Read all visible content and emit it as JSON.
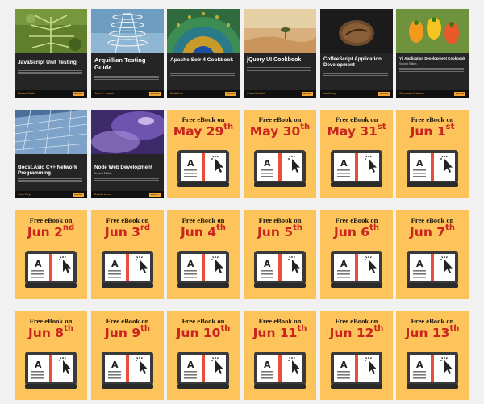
{
  "colors": {
    "page_background": "#f1f1f1",
    "ebook_background": "#fcc45a",
    "ebook_date_color": "#c9241d",
    "book_dark": "#252525",
    "publisher_orange": "#f4a532"
  },
  "book_covers": [
    {
      "title": "JavaScript Unit Testing",
      "subtitle": "",
      "author": "Hazem Saleh",
      "publisher": "PACKT"
    },
    {
      "title": "Arquillian Testing Guide",
      "subtitle": "",
      "author": "John D. Ament",
      "publisher": "PACKT"
    },
    {
      "title": "Apache Solr 4 Cookbook",
      "subtitle": "",
      "author": "Rafał Kuć",
      "publisher": "PACKT"
    },
    {
      "title": "jQuery UI Cookbook",
      "subtitle": "",
      "author": "Adam Boduch",
      "publisher": "PACKT"
    },
    {
      "title": "CoffeeScript Application Development",
      "subtitle": "",
      "author": "Ian Young",
      "publisher": "PACKT"
    },
    {
      "title": "Yii Application Development Cookbook",
      "subtitle": "Second Edition",
      "author": "Alexander Makarov",
      "publisher": "PACKT"
    },
    {
      "title": "Boost.Asio C++ Network Programming",
      "subtitle": "",
      "author": "John Torjo",
      "publisher": "PACKT"
    },
    {
      "title": "Node Web Development",
      "subtitle": "Second Edition",
      "author": "David Herron",
      "publisher": "PACKT"
    }
  ],
  "free_ebooks": {
    "label": "Free eBook on",
    "dates": [
      {
        "text": "May 29",
        "suffix": "th"
      },
      {
        "text": "May 30",
        "suffix": "th"
      },
      {
        "text": "May 31",
        "suffix": "st"
      },
      {
        "text": "Jun 1",
        "suffix": "st"
      },
      {
        "text": "Jun 2",
        "suffix": "nd"
      },
      {
        "text": "Jun 3",
        "suffix": "rd"
      },
      {
        "text": "Jun 4",
        "suffix": "th"
      },
      {
        "text": "Jun 5",
        "suffix": "th"
      },
      {
        "text": "Jun 6",
        "suffix": "th"
      },
      {
        "text": "Jun 7",
        "suffix": "th"
      },
      {
        "text": "Jun 8",
        "suffix": "th"
      },
      {
        "text": "Jun 9",
        "suffix": "th"
      },
      {
        "text": "Jun 10",
        "suffix": "th"
      },
      {
        "text": "Jun 11",
        "suffix": "th"
      },
      {
        "text": "Jun 12",
        "suffix": "th"
      },
      {
        "text": "Jun 13",
        "suffix": "th"
      }
    ],
    "book_icon_letter": "A"
  }
}
